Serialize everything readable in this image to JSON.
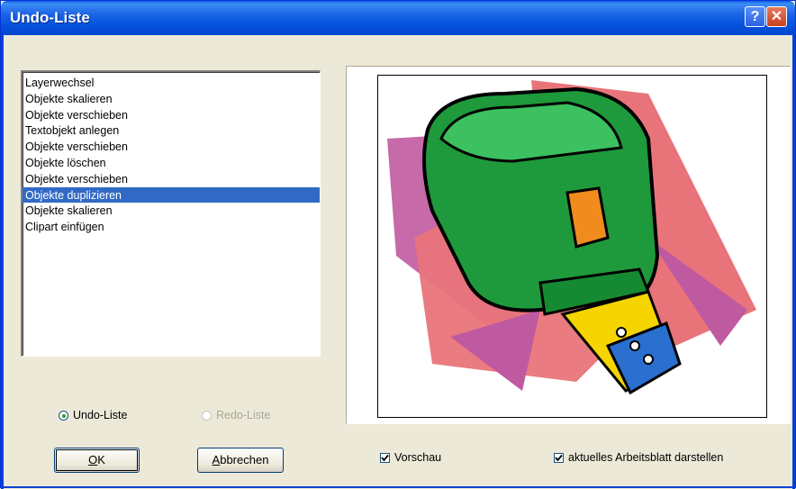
{
  "window": {
    "title": "Undo-Liste",
    "help_glyph": "?",
    "close_glyph": "✕"
  },
  "undo_list": {
    "items": [
      "Layerwechsel",
      "Objekte skalieren",
      "Objekte verschieben",
      "Textobjekt anlegen",
      "Objekte verschieben",
      "Objekte löschen",
      "Objekte verschieben",
      "Objekte duplizieren",
      "Objekte skalieren",
      "Clipart einfügen"
    ],
    "selected_index": 7
  },
  "mode": {
    "undo_label": "Undo-Liste",
    "redo_label": "Redo-Liste",
    "selected": "undo"
  },
  "buttons": {
    "ok_mnemonic": "O",
    "ok_rest": "K",
    "cancel_mnemonic": "A",
    "cancel_rest": "bbrechen"
  },
  "options": {
    "preview_label": "Vorschau",
    "preview_checked": true,
    "sheet_label": "aktuelles Arbeitsblatt darstellen",
    "sheet_checked": true
  },
  "preview_image": {
    "icon": "tape-measure-clipart",
    "colors": {
      "green": "#1e9a3c",
      "pink": "#e8747a",
      "purple": "#c05aa0",
      "yellow": "#f5d400",
      "blue": "#2a6fd0"
    }
  }
}
